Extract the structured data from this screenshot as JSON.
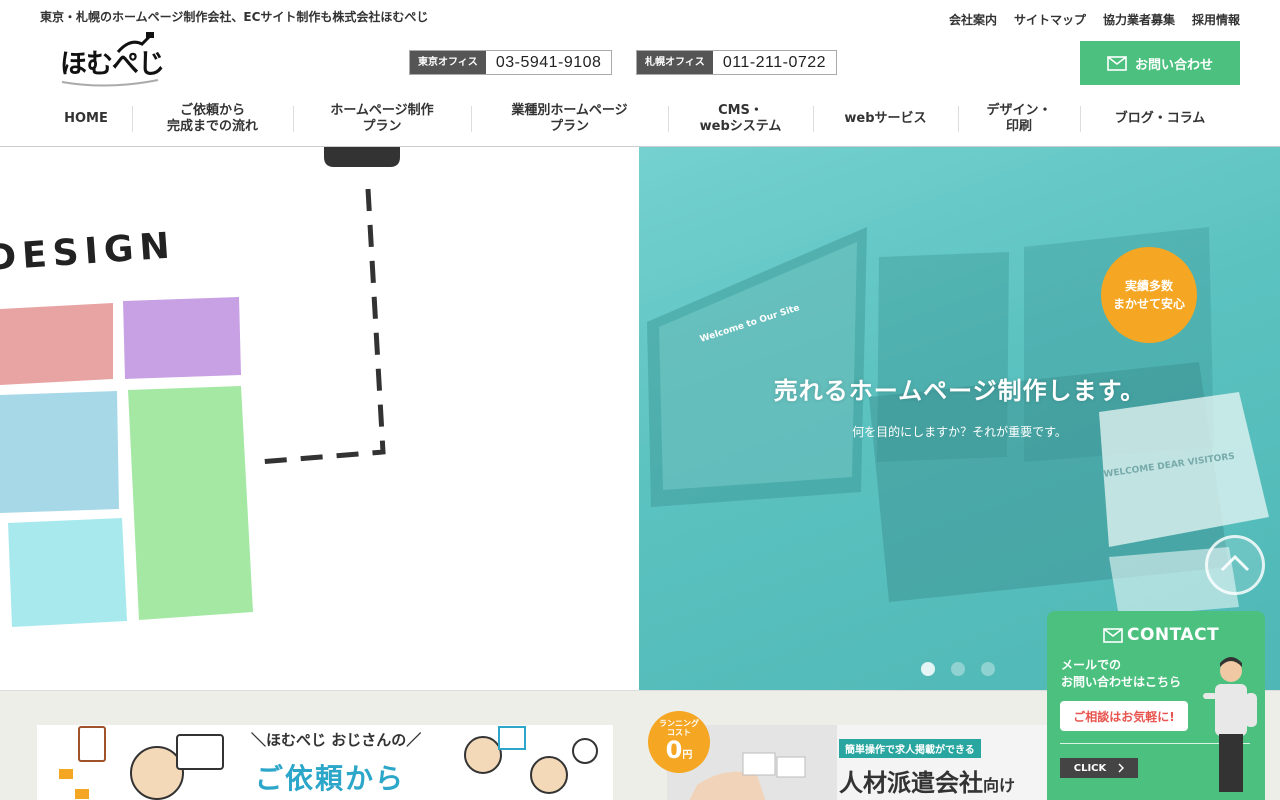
{
  "header": {
    "tagline": "東京・札幌のホームページ制作会社、ECサイト制作も株式会社ほむぺじ",
    "util_links": [
      "会社案内",
      "サイトマップ",
      "協力業者募集",
      "採用情報"
    ],
    "logo_text": "ほむぺじ",
    "offices": [
      {
        "label": "東京オフィス",
        "phone": "03-5941-9108"
      },
      {
        "label": "札幌オフィス",
        "phone": "011-211-0722"
      }
    ],
    "contact_button": "お問い合わせ"
  },
  "nav": [
    {
      "label": "HOME",
      "width": 92
    },
    {
      "label": "ご依頼から\n完成までの流れ",
      "width": 161
    },
    {
      "label": "ホームページ制作\nプラン",
      "width": 178
    },
    {
      "label": "業種別ホームページ\nプラン",
      "width": 197
    },
    {
      "label": "CMS・\nwebシステム",
      "width": 145
    },
    {
      "label": "webサービス",
      "width": 145
    },
    {
      "label": "デザイン・\n印刷",
      "width": 122
    },
    {
      "label": "ブログ・コラム",
      "width": 160
    }
  ],
  "hero": {
    "left_word": "DESIGN",
    "badge_line1": "実績多数",
    "badge_line2": "まかせて安心",
    "headline": "売れるホームページ制作します。",
    "sub": "何を目的にしますか？それが重要です。",
    "screen_caption_1": "Welcome to Our Site",
    "screen_caption_2": "WELCOME DEAR VISITORS",
    "slide_count": 3,
    "active_slide": 0
  },
  "lower": {
    "left_banner_prefix": "＼ほむぺじ おじさんの／",
    "left_banner_title": "ご依頼から",
    "cost_badge_top": "ランニング\nコスト",
    "cost_badge_value": "0",
    "cost_badge_unit": "円",
    "right_banner_label": "簡単操作で求人掲載ができる",
    "right_banner_title": "人材派遣会社",
    "right_banner_suffix": "向け"
  },
  "contact_widget": {
    "title": "CONTACT",
    "text": "メールでの\nお問い合わせはこちら",
    "bubble": "ご相談はお気軽に!",
    "click": "CLICK"
  },
  "colors": {
    "accent_green": "#4cc17f",
    "hero_teal": "#5bc2c0",
    "badge_orange": "#f5a623"
  }
}
